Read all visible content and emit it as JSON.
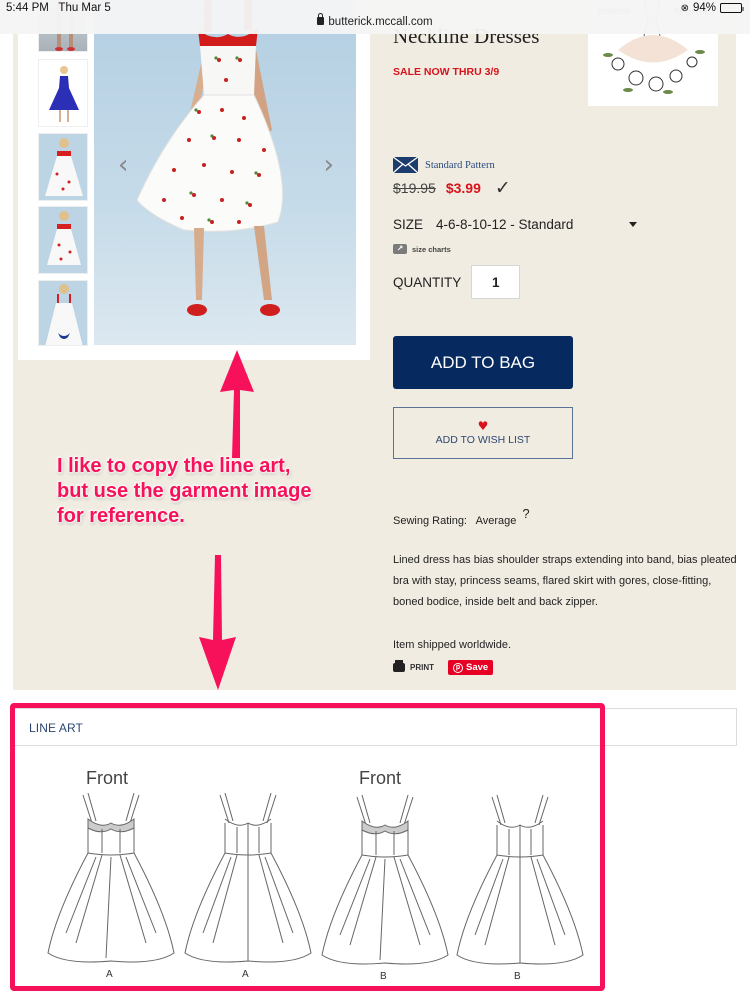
{
  "status_bar": {
    "time": "5:44 PM",
    "date": "Thu Mar 5",
    "battery": "94%",
    "battery_level": 0.94
  },
  "url_bar": {
    "domain": "butterick.mccall.com"
  },
  "gallery": {
    "thumbnails": [
      {
        "alt": "dress-legs-thumbnail"
      },
      {
        "alt": "blue-dress-illustration-thumbnail"
      },
      {
        "alt": "cherry-dress-front-thumbnail"
      },
      {
        "alt": "cherry-dress-front-2-thumbnail"
      },
      {
        "alt": "cherry-dress-back-thumbnail"
      }
    ],
    "prev_icon": "chevron-left",
    "next_icon": "chevron-right"
  },
  "product": {
    "title": "Neckline Dresses",
    "sale_banner": "SALE NOW THRU 3/9",
    "pattern_type": "Standard Pattern",
    "old_price": "$19.95",
    "new_price": "$3.99",
    "size_label": "SIZE",
    "size_value": "4-6-8-10-12 - Standard",
    "size_charts_label": "size charts",
    "quantity_label": "QUANTITY",
    "quantity_value": "1",
    "add_to_bag": "ADD TO BAG",
    "add_to_wishlist": "ADD TO WISH LIST",
    "sewing_rating_label": "Sewing Rating:",
    "sewing_rating_value": "Average",
    "sewing_rating_help": "?",
    "description": "Lined dress has bias shoulder straps extending into band, bias pleated bra with stay, princess seams, flared skirt with gores, close-fitting, boned bodice, inside belt and back zipper.",
    "shipping_note": "Item shipped worldwide.",
    "print_label": "PRINT",
    "pinterest_save": "Save"
  },
  "annotation": {
    "text": "I like to copy the line art, but use the garment image for reference.",
    "color": "#f7105a"
  },
  "line_art": {
    "title": "LINE ART",
    "views": [
      {
        "heading": "Front",
        "view": "A"
      },
      {
        "heading": "",
        "view": "A"
      },
      {
        "heading": "Front",
        "view": "B"
      },
      {
        "heading": "",
        "view": "B"
      }
    ]
  },
  "colors": {
    "sale_red": "#d7141b",
    "navy": "#062a60",
    "beige": "#f1ece2",
    "annotation_pink": "#f7105a"
  }
}
